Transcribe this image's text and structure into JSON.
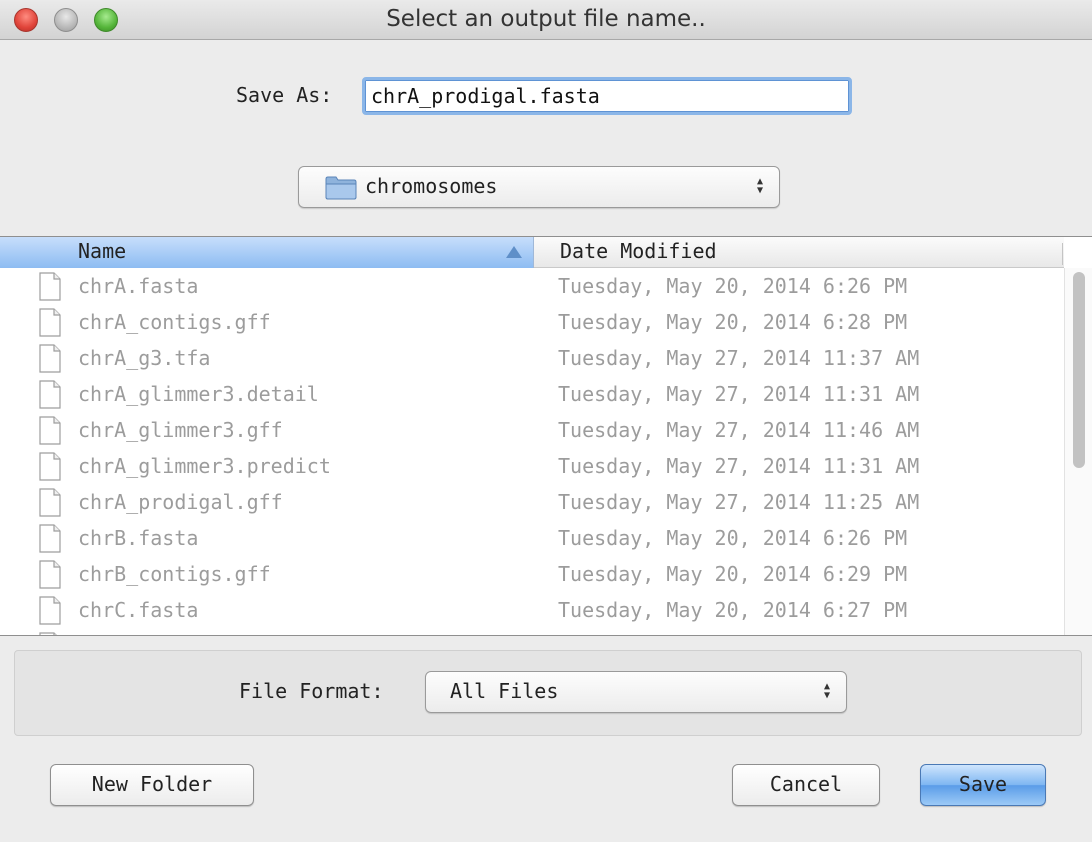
{
  "window": {
    "title": "Select an output file name.."
  },
  "save_as": {
    "label": "Save As:",
    "value": "chrA_prodigal.fasta"
  },
  "location": {
    "folder": "chromosomes",
    "icon": "folder-icon"
  },
  "file_browser": {
    "columns": [
      "Name",
      "Date Modified"
    ],
    "sorted_by": "Name",
    "files": [
      {
        "name": "chrA.fasta",
        "date": "Tuesday, May 20, 2014 6:26 PM"
      },
      {
        "name": "chrA_contigs.gff",
        "date": "Tuesday, May 20, 2014 6:28 PM"
      },
      {
        "name": "chrA_g3.tfa",
        "date": "Tuesday, May 27, 2014 11:37 AM"
      },
      {
        "name": "chrA_glimmer3.detail",
        "date": "Tuesday, May 27, 2014 11:31 AM"
      },
      {
        "name": "chrA_glimmer3.gff",
        "date": "Tuesday, May 27, 2014 11:46 AM"
      },
      {
        "name": "chrA_glimmer3.predict",
        "date": "Tuesday, May 27, 2014 11:31 AM"
      },
      {
        "name": "chrA_prodigal.gff",
        "date": "Tuesday, May 27, 2014 11:25 AM"
      },
      {
        "name": "chrB.fasta",
        "date": "Tuesday, May 20, 2014 6:26 PM"
      },
      {
        "name": "chrB_contigs.gff",
        "date": "Tuesday, May 20, 2014 6:29 PM"
      },
      {
        "name": "chrC.fasta",
        "date": "Tuesday, May 20, 2014 6:27 PM"
      }
    ]
  },
  "file_format": {
    "label": "File Format:",
    "value": "All Files"
  },
  "buttons": {
    "new_folder": "New Folder",
    "cancel": "Cancel",
    "save": "Save"
  },
  "colors": {
    "accent": "#8dbcf2",
    "dimmed_text": "#9c9c9c",
    "window_bg": "#ececec"
  }
}
